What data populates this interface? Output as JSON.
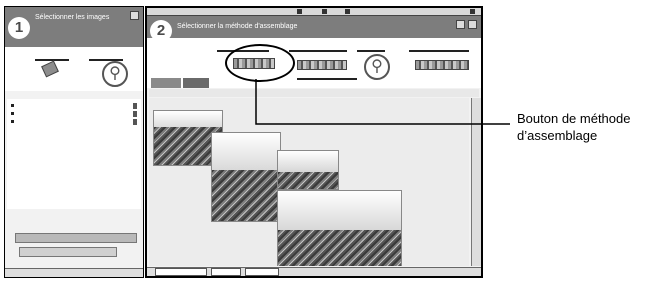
{
  "callout": {
    "line1": "Bouton de méthode",
    "line2": "d’assemblage"
  },
  "left_window": {
    "step": "1",
    "title": "Sélectionner les images"
  },
  "right_window": {
    "step": "2",
    "title": "Sélectionner la méthode d'assemblage"
  },
  "icons": {
    "sheets": "sheets-icon",
    "wrench": "wrench-icon"
  },
  "colors": {
    "titlebar": "#7d7d7d",
    "callout_text": "#000000",
    "canvas": "#ececec"
  }
}
